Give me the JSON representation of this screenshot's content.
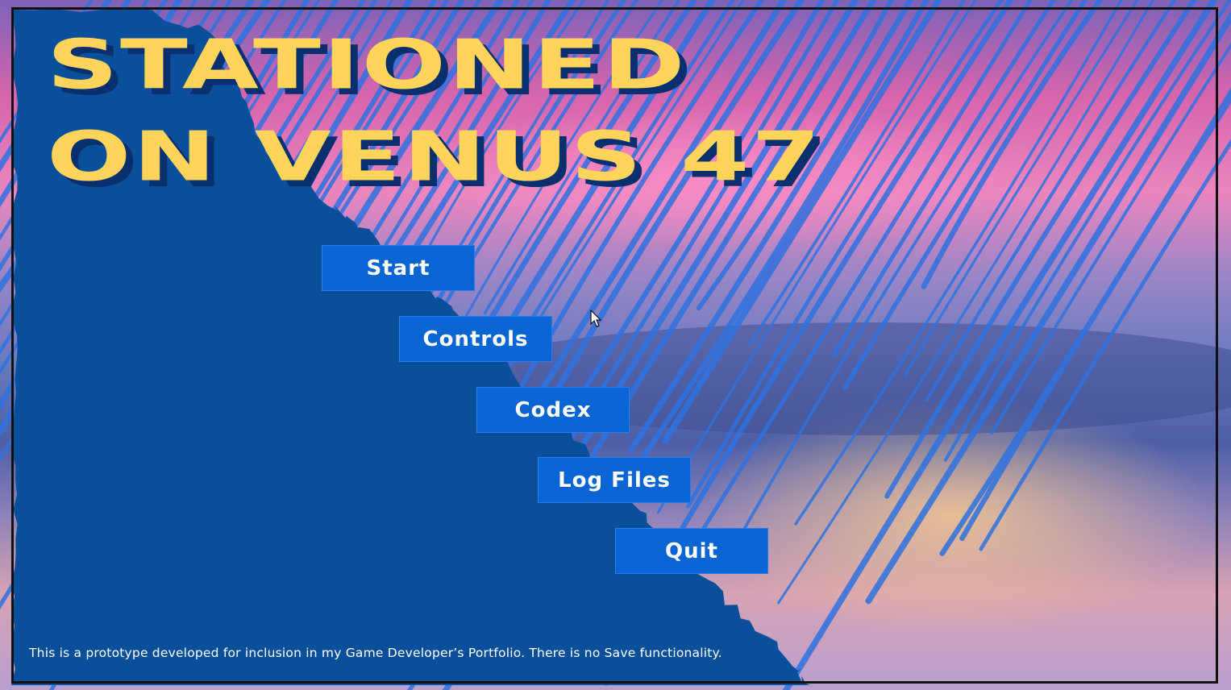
{
  "title": {
    "line1": "STATIONED",
    "line2": "ON VENUS 47"
  },
  "menu": {
    "start": "Start",
    "controls": "Controls",
    "codex": "Codex",
    "log_files": "Log Files",
    "quit": "Quit"
  },
  "footer": {
    "disclaimer": "This is a prototype developed for inclusion in my Game Developer’s Portfolio. There is no Save functionality."
  },
  "colors": {
    "title_fill": "#ffd45a",
    "title_shadow": "#0a2f6e",
    "panel_blue": "#0a4f9a",
    "button_blue": "#0a65d4",
    "scribble_blue": "#2f72e0"
  }
}
